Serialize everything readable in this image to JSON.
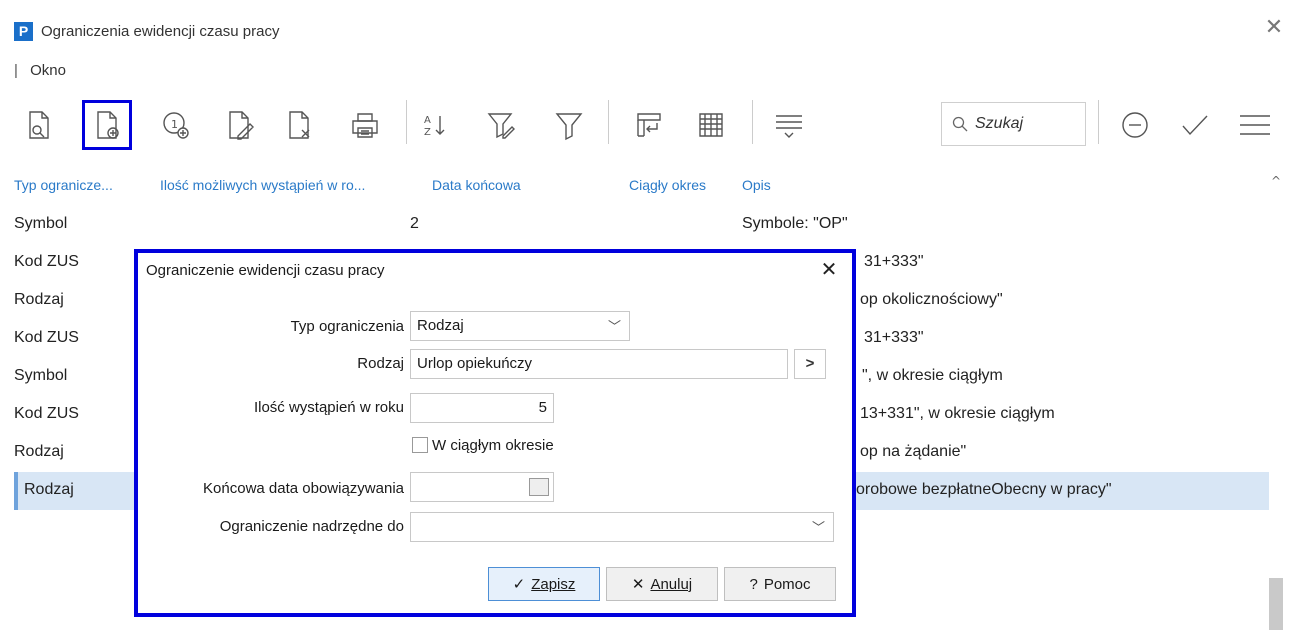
{
  "window": {
    "app_logo": "P",
    "title": "Ograniczenia ewidencji czasu pracy",
    "close_icon": "close-icon"
  },
  "menubar": {
    "separator": "|",
    "items": [
      "Okno"
    ]
  },
  "toolbar": {
    "icons": [
      "view-document-icon",
      "new-document-icon",
      "add-numbered-icon",
      "edit-document-icon",
      "delete-document-icon",
      "print-icon",
      "sort-az-icon",
      "filter-edit-icon",
      "filter-icon",
      "columns-icon",
      "grid-icon",
      "collapse-list-icon",
      "minus-circle-icon",
      "checkmark-icon",
      "menu-icon"
    ],
    "search_placeholder": "Szukaj"
  },
  "grid": {
    "headers": [
      "Typ ogranicze...",
      "Ilość możliwych wystąpień w ro...",
      "Data końcowa",
      "Ciągły okres",
      "Opis"
    ],
    "rows": [
      {
        "typ": "Symbol",
        "ilosc": "2",
        "opis": "Symbole: \"OP\""
      },
      {
        "typ": "Kod ZUS",
        "ilosc": "",
        "opis": "31+333\""
      },
      {
        "typ": "Rodzaj",
        "ilosc": "",
        "opis": "op okolicznościowy\""
      },
      {
        "typ": "Kod ZUS",
        "ilosc": "",
        "opis": "31+333\""
      },
      {
        "typ": "Symbol",
        "ilosc": "",
        "opis": "\", w okresie ciągłym"
      },
      {
        "typ": "Kod ZUS",
        "ilosc": "",
        "opis": "13+331\", w okresie ciągłym"
      },
      {
        "typ": "Rodzaj",
        "ilosc": "",
        "opis": "op na żądanie\""
      },
      {
        "typ": "Rodzaj",
        "ilosc": "",
        "opis": "orobowe bezpłatneObecny w pracy\""
      }
    ],
    "selected_row": 7
  },
  "dialog": {
    "title": "Ograniczenie ewidencji czasu pracy",
    "typ_label": "Typ ograniczenia",
    "typ_value": "Rodzaj",
    "rodzaj_label": "Rodzaj",
    "rodzaj_value": "Urlop opiekuńczy",
    "rodzaj_button": ">",
    "ilosc_label": "Ilość wystąpień w roku",
    "ilosc_value": "5",
    "ciagly_label": "W ciągłym okresie",
    "ciagly_checked": false,
    "data_label": "Końcowa data obowiązywania",
    "data_value": "",
    "nadrzedne_label": "Ograniczenie nadrzędne do",
    "nadrzedne_value": "",
    "save_label": "Zapisz",
    "cancel_label": "Anuluj",
    "help_label": "Pomoc"
  }
}
